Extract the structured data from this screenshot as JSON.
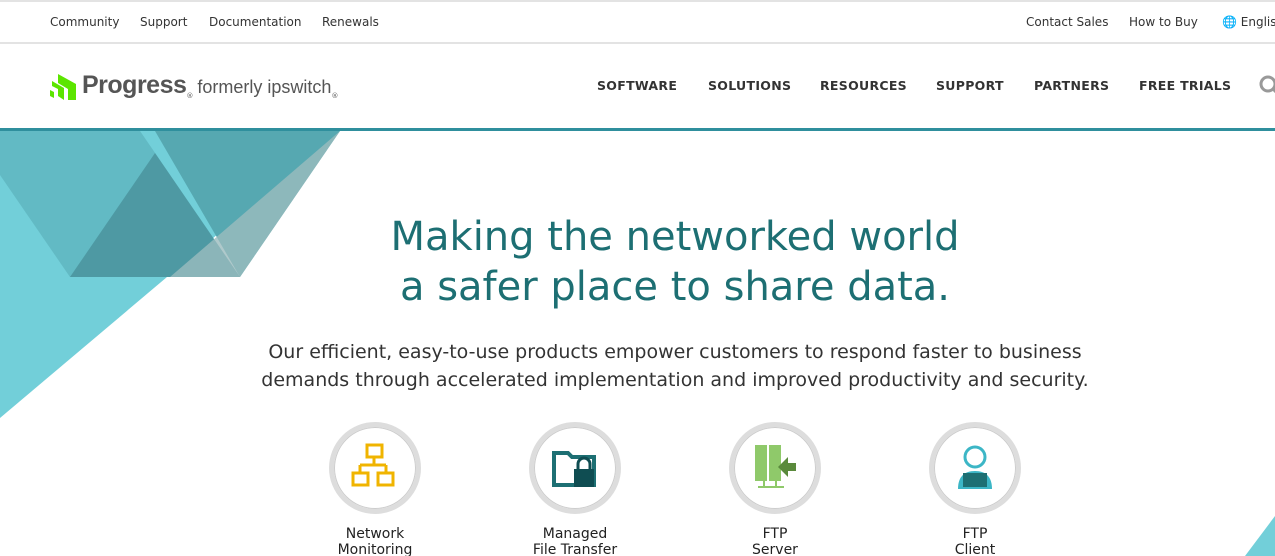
{
  "topbar": {
    "left": [
      "Community",
      "Support",
      "Documentation",
      "Renewals"
    ],
    "right": [
      "Contact Sales",
      "How to Buy",
      "English"
    ]
  },
  "logo": {
    "brand": "Progress",
    "sub": "formerly ipswitch",
    "brand_color": "#5ce500"
  },
  "nav": [
    "SOFTWARE",
    "SOLUTIONS",
    "RESOURCES",
    "SUPPORT",
    "PARTNERS",
    "FREE TRIALS"
  ],
  "hero": {
    "line1": "Making the networked world",
    "line2": "a safer place to share data.",
    "lead1": "Our efficient, easy-to-use products empower customers to respond faster to business",
    "lead2": "demands through accelerated implementation and improved productivity and security."
  },
  "products": [
    {
      "l1": "Network",
      "l2": "Monitoring",
      "icon": "network-icon"
    },
    {
      "l1": "Managed",
      "l2": "File Transfer",
      "icon": "locked-folder-icon"
    },
    {
      "l1": "FTP",
      "l2": "Server",
      "icon": "server-icon"
    },
    {
      "l1": "FTP",
      "l2": "Client",
      "icon": "user-laptop-icon"
    }
  ],
  "colors": {
    "accent": "#1d6f73",
    "teal_light": "#72cfd9"
  }
}
